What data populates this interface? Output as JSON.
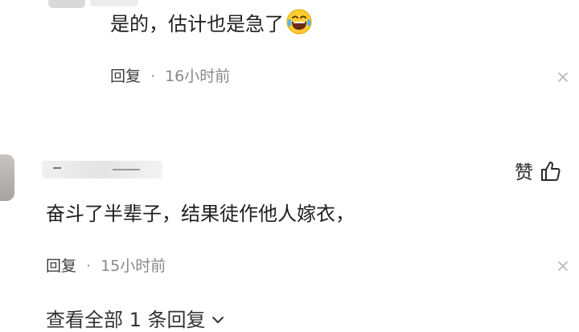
{
  "reply_comment": {
    "text": "是的，估计也是急了",
    "emoji": "laughing-with-tears",
    "reply_label": "回复",
    "separator": "·",
    "time": "16小时前"
  },
  "main_comment": {
    "like_label": "赞",
    "text": "奋斗了半辈子，结果徒作他人嫁衣，",
    "reply_label": "回复",
    "separator": "·",
    "time": "15小时前",
    "view_all_label": "查看全部 1 条回复"
  },
  "icons": {
    "close": "close-icon",
    "thumbs_up": "thumbs-up-icon",
    "chevron": "chevron-down-icon"
  }
}
